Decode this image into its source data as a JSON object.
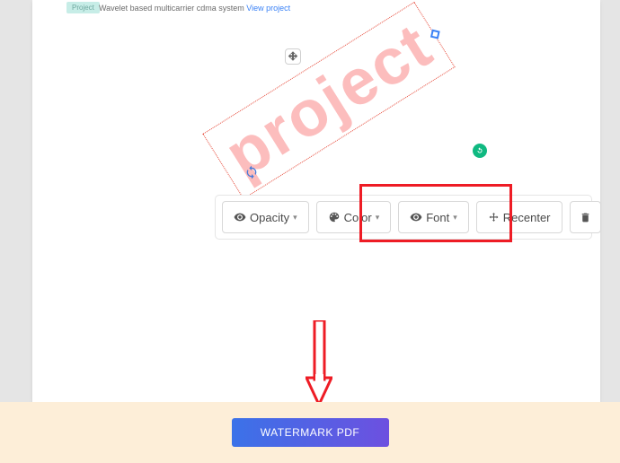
{
  "document": {
    "badge": "Project",
    "line": "Wavelet based multicarrier cdma system",
    "link": "View project"
  },
  "watermark": {
    "text": "project"
  },
  "toolbar": {
    "opacity": "Opacity",
    "color": "Color",
    "font": "Font",
    "recenter": "Recenter"
  },
  "cta": {
    "label": "WATERMARK PDF"
  }
}
